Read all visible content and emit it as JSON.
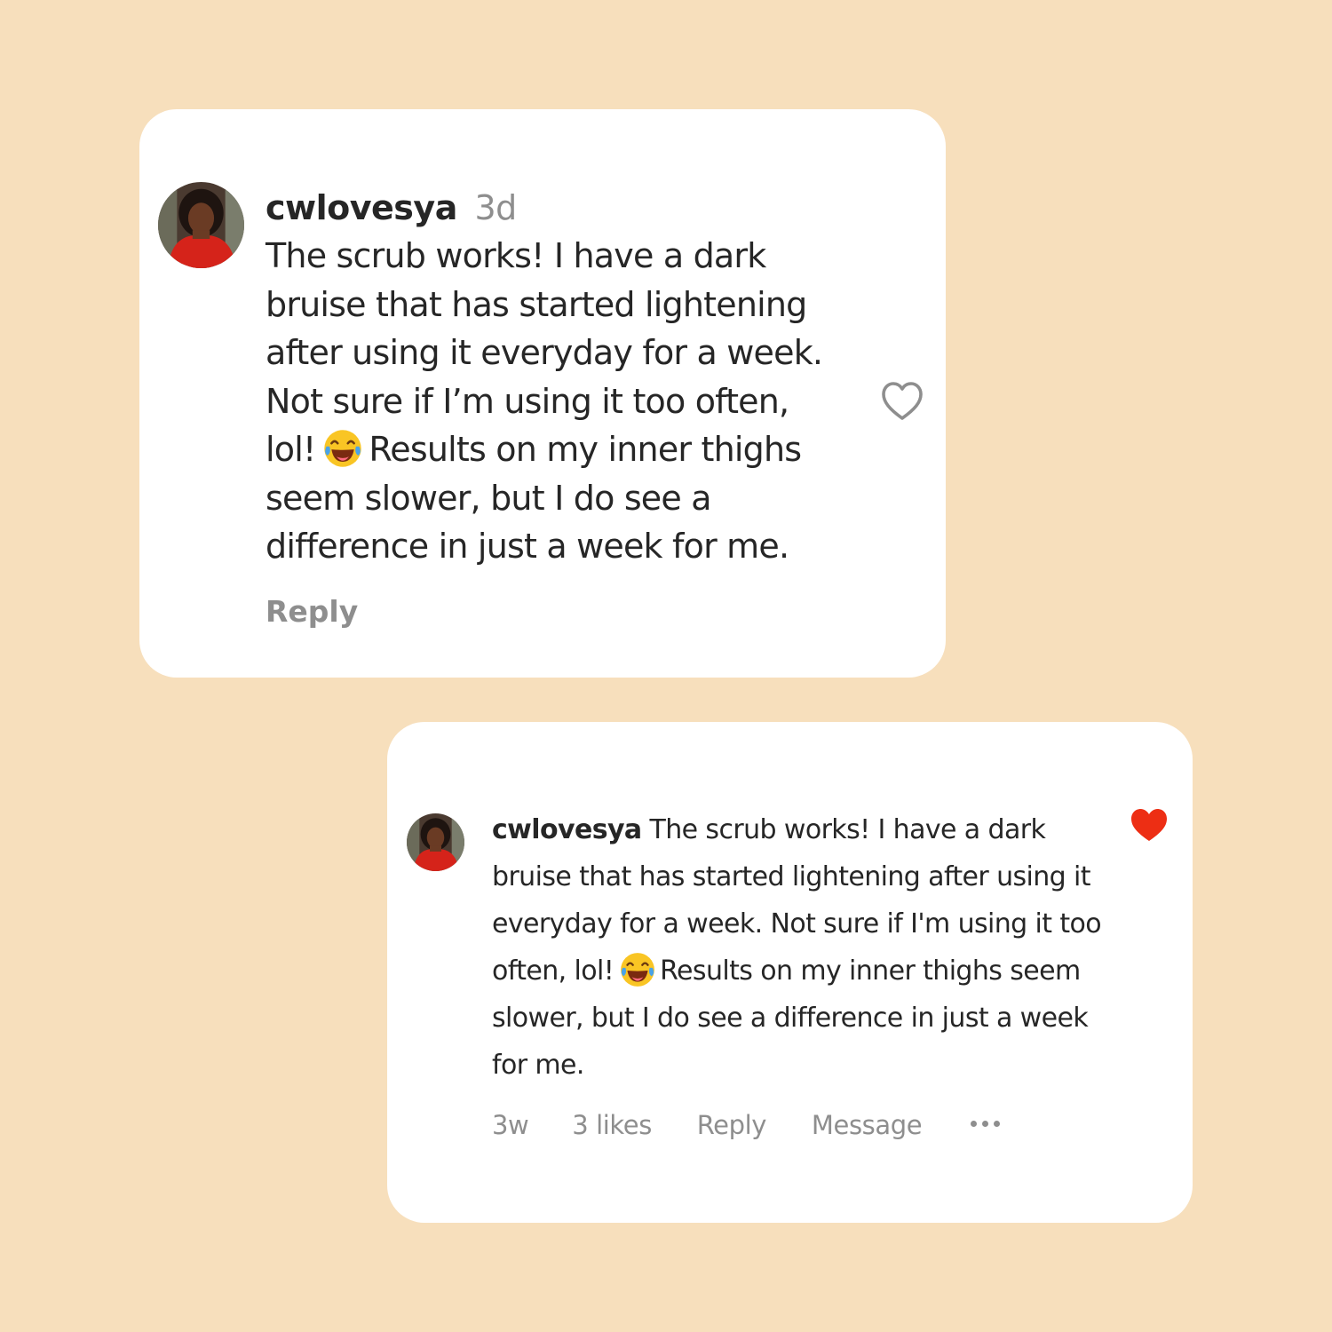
{
  "colors": {
    "background": "#f7dfbc",
    "card": "#ffffff",
    "text": "#262626",
    "muted": "#8e8e8e",
    "heart_liked": "#ed2e14"
  },
  "comment_large": {
    "username": "cwlovesya",
    "time": "3d",
    "body_lines": [
      "The scrub works! I have a dark",
      "bruise that has started lightening",
      "after using it everyday for a week.",
      "Not sure if I’m using it too often,",
      "lol!",
      "Results on my inner thighs",
      "seem slower, but I do see a",
      "difference in just a week for me."
    ],
    "emoji": "face-with-tears-of-joy-icon",
    "reply_label": "Reply",
    "like_icon": "heart-outline-icon"
  },
  "comment_small": {
    "username": "cwlovesya",
    "body_lines": [
      "The scrub works! I have a dark",
      "bruise that has started lightening after using it",
      "everyday for a week. Not sure if I'm using it too",
      "often, lol!",
      "Results on my inner thighs seem",
      "slower, but I do see a difference in just a week",
      "for me."
    ],
    "emoji": "face-with-tears-of-joy-icon",
    "time": "3w",
    "likes": "3 likes",
    "reply_label": "Reply",
    "message_label": "Message",
    "more_icon": "more-dots-icon",
    "like_icon": "heart-filled-icon"
  }
}
